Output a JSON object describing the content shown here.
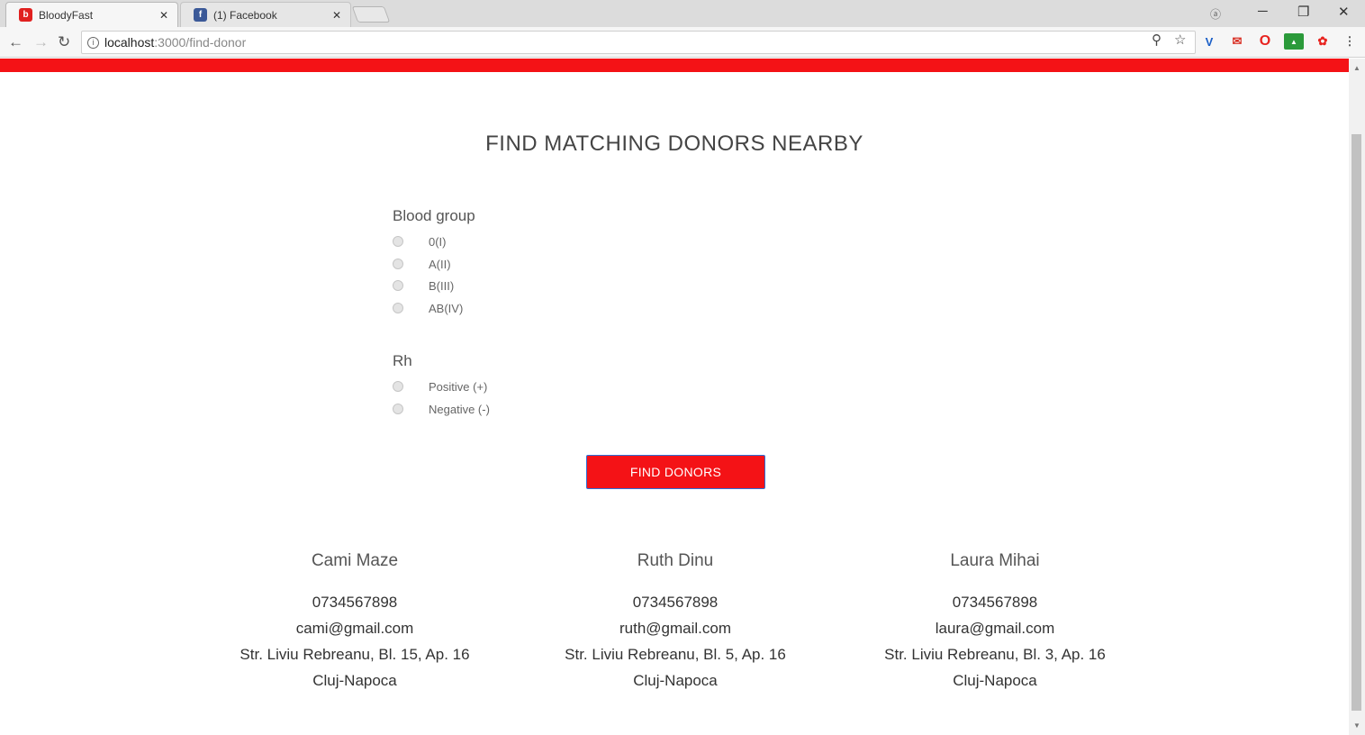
{
  "browser": {
    "tabs": [
      {
        "title": "BloodyFast",
        "favicon": "bloodyfast-favicon",
        "color": "#e0201f"
      },
      {
        "title": "(1) Facebook",
        "favicon": "facebook-favicon",
        "color": "#3b5998"
      }
    ],
    "url_host": "localhost",
    "url_path": ":3000/find-donor"
  },
  "page": {
    "title": "FIND MATCHING DONORS NEARBY",
    "blood_group": {
      "label": "Blood group",
      "options": [
        "0(I)",
        "A(II)",
        "B(III)",
        "AB(IV)"
      ]
    },
    "rh": {
      "label": "Rh",
      "options": [
        "Positive (+)",
        "Negative (-)"
      ]
    },
    "find_button": "FIND DONORS",
    "donors": [
      {
        "name": "Cami Maze",
        "phone": "0734567898",
        "email": "cami@gmail.com",
        "address": "Str. Liviu Rebreanu, Bl. 15, Ap. 16",
        "city": "Cluj-Napoca"
      },
      {
        "name": "Ruth Dinu",
        "phone": "0734567898",
        "email": "ruth@gmail.com",
        "address": "Str. Liviu Rebreanu, Bl. 5, Ap. 16",
        "city": "Cluj-Napoca"
      },
      {
        "name": "Laura Mihai",
        "phone": "0734567898",
        "email": "laura@gmail.com",
        "address": "Str. Liviu Rebreanu, Bl. 3, Ap. 16",
        "city": "Cluj-Napoca"
      }
    ]
  },
  "colors": {
    "brand_red": "#f41216",
    "button_border": "#2c6fd6"
  }
}
